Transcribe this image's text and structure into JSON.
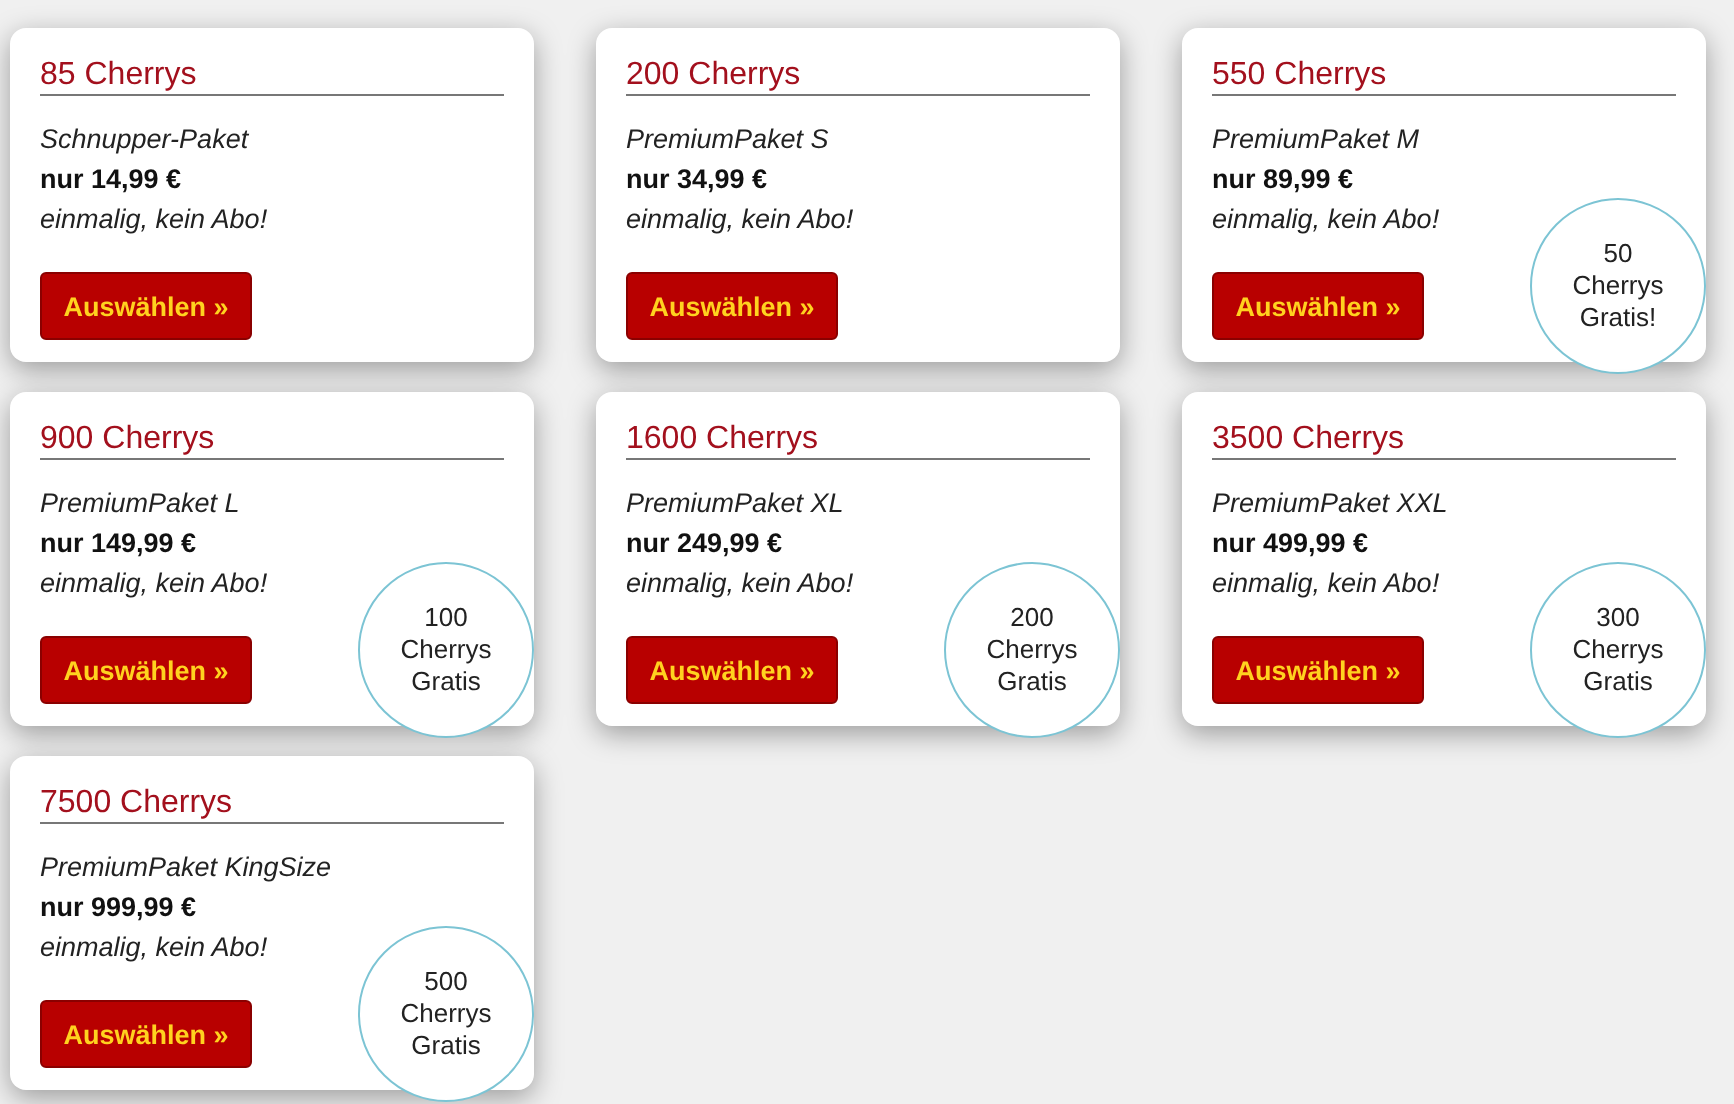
{
  "packages": [
    {
      "title": "85 Cherrys",
      "name": "Schnupper-Paket",
      "price": "nur 14,99 €",
      "note": "einmalig, kein Abo!",
      "button": "Auswählen »"
    },
    {
      "title": "200 Cherrys",
      "name": "PremiumPaket S",
      "price": "nur 34,99 €",
      "note": "einmalig, kein Abo!",
      "button": "Auswählen »"
    },
    {
      "title": "550 Cherrys",
      "name": "PremiumPaket M",
      "price": "nur 89,99 €",
      "note": "einmalig, kein Abo!",
      "button": "Auswählen »",
      "badge": "50 Cherrys Gratis!"
    },
    {
      "title": "900 Cherrys",
      "name": "PremiumPaket L",
      "price": "nur 149,99 €",
      "note": "einmalig, kein Abo!",
      "button": "Auswählen »",
      "badge": "100 Cherrys Gratis"
    },
    {
      "title": "1600 Cherrys",
      "name": "PremiumPaket XL",
      "price": "nur 249,99 €",
      "note": "einmalig, kein Abo!",
      "button": "Auswählen »",
      "badge": "200 Cherrys Gratis"
    },
    {
      "title": "3500 Cherrys",
      "name": "PremiumPaket XXL",
      "price": "nur 499,99 €",
      "note": "einmalig, kein Abo!",
      "button": "Auswählen »",
      "badge": "300 Cherrys Gratis"
    },
    {
      "title": "7500 Cherrys",
      "name": "PremiumPaket KingSize",
      "price": "nur 999,99 €",
      "note": "einmalig, kein Abo!",
      "button": "Auswählen »",
      "badge": "500 Cherrys Gratis"
    }
  ]
}
